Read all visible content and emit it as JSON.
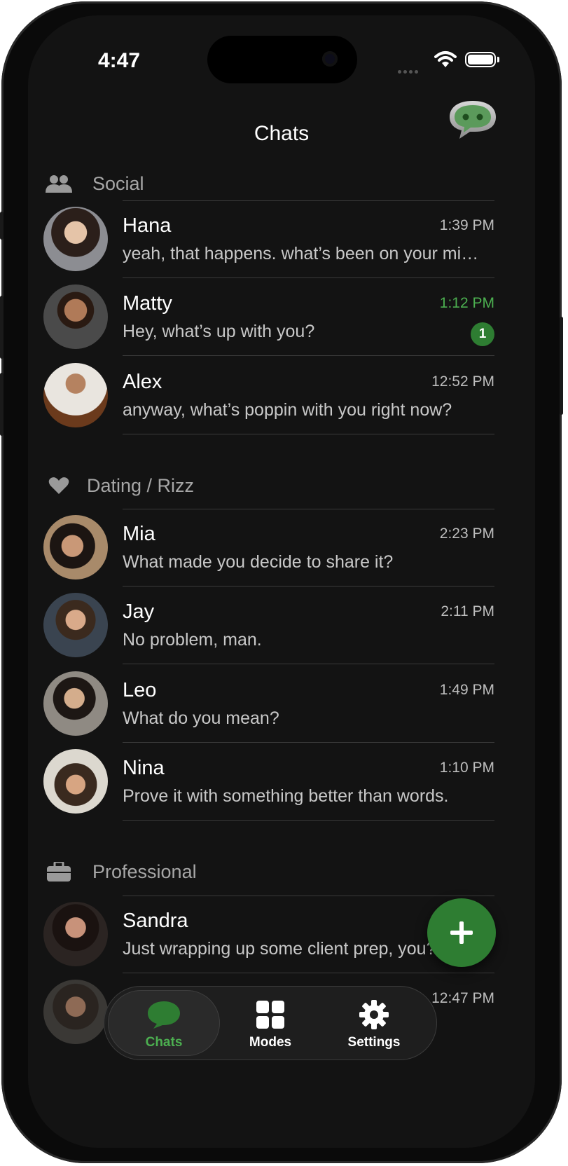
{
  "status_bar": {
    "time": "4:47"
  },
  "header": {
    "title": "Chats"
  },
  "sections": [
    {
      "title": "Social",
      "icon": "people-icon",
      "chats": [
        {
          "name": "Hana",
          "time": "1:39 PM",
          "preview": "yeah, that happens. what’s been on your mind?",
          "unread": false
        },
        {
          "name": "Matty",
          "time": "1:12 PM",
          "preview": "Hey, what’s up with you?",
          "unread": true,
          "badge": "1"
        },
        {
          "name": "Alex",
          "time": "12:52 PM",
          "preview": "anyway, what’s poppin with you right now?",
          "unread": false
        }
      ]
    },
    {
      "title": "Dating / Rizz",
      "icon": "heart-icon",
      "chats": [
        {
          "name": "Mia",
          "time": "2:23 PM",
          "preview": "What made you decide to share it?",
          "unread": false
        },
        {
          "name": "Jay",
          "time": "2:11 PM",
          "preview": "No problem, man.",
          "unread": false
        },
        {
          "name": "Leo",
          "time": "1:49 PM",
          "preview": "What do you mean?",
          "unread": false
        },
        {
          "name": "Nina",
          "time": "1:10 PM",
          "preview": "Prove it with something better than words.",
          "unread": false
        }
      ]
    },
    {
      "title": "Professional",
      "icon": "briefcase-icon",
      "chats": [
        {
          "name": "Sandra",
          "time": "",
          "preview": "Just wrapping up some client prep, you?",
          "unread": false
        },
        {
          "name": "",
          "time": "12:47 PM",
          "preview": "",
          "unread": false
        }
      ]
    }
  ],
  "tabbar": {
    "tabs": [
      {
        "label": "Chats",
        "icon": "chat-bubble-icon",
        "active": true
      },
      {
        "label": "Modes",
        "icon": "grid-icon",
        "active": false
      },
      {
        "label": "Settings",
        "icon": "gear-icon",
        "active": false
      }
    ]
  },
  "colors": {
    "accent": "#2e7d32",
    "accent_text": "#4caf50",
    "background": "#131313"
  }
}
